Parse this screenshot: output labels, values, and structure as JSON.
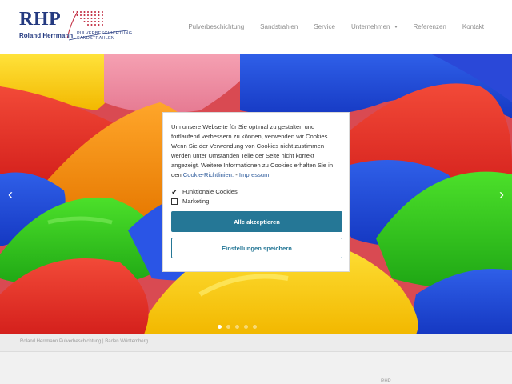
{
  "logo": {
    "mark": "RHP",
    "name": "Roland Herrmann",
    "line1": "PULVERBESCHICHTUNG",
    "line2": "SANDSTRAHLEN",
    "color": "#243a80"
  },
  "nav": {
    "items": [
      "Pulverbeschichtung",
      "Sandstrahlen",
      "Service",
      "Unternehmen",
      "Referenzen",
      "Kontakt"
    ]
  },
  "hero": {
    "prev_icon": "chevron-left-icon",
    "next_icon": "chevron-right-icon",
    "prev_glyph": "‹",
    "next_glyph": "›",
    "slide_count": 5,
    "active_slide": 1
  },
  "cookie": {
    "text_before": "Um unsere Webseite für Sie optimal zu gestalten und fortlaufend verbessern zu können, verwenden wir Cookies. Wenn Sie der Verwendung von Cookies nicht zustimmen werden unter Umständen Teile der Seite nicht korrekt angezeigt. Weitere Informationen zu Cookies erhalten Sie in den",
    "policy_link": "Cookie-Richtlinien.",
    "separator": "-",
    "imprint_link": "Impressum",
    "options": [
      {
        "label": "Funktionale Cookies",
        "checked": true
      },
      {
        "label": "Marketing",
        "checked": false
      }
    ],
    "accept_label": "Alle akzeptieren",
    "save_label": "Einstellungen speichern",
    "accent": "#257796"
  },
  "caption": {
    "text": "Roland Herrmann Pulverbeschichtung | Baden Württemberg"
  },
  "corner": {
    "text": "RHP"
  }
}
